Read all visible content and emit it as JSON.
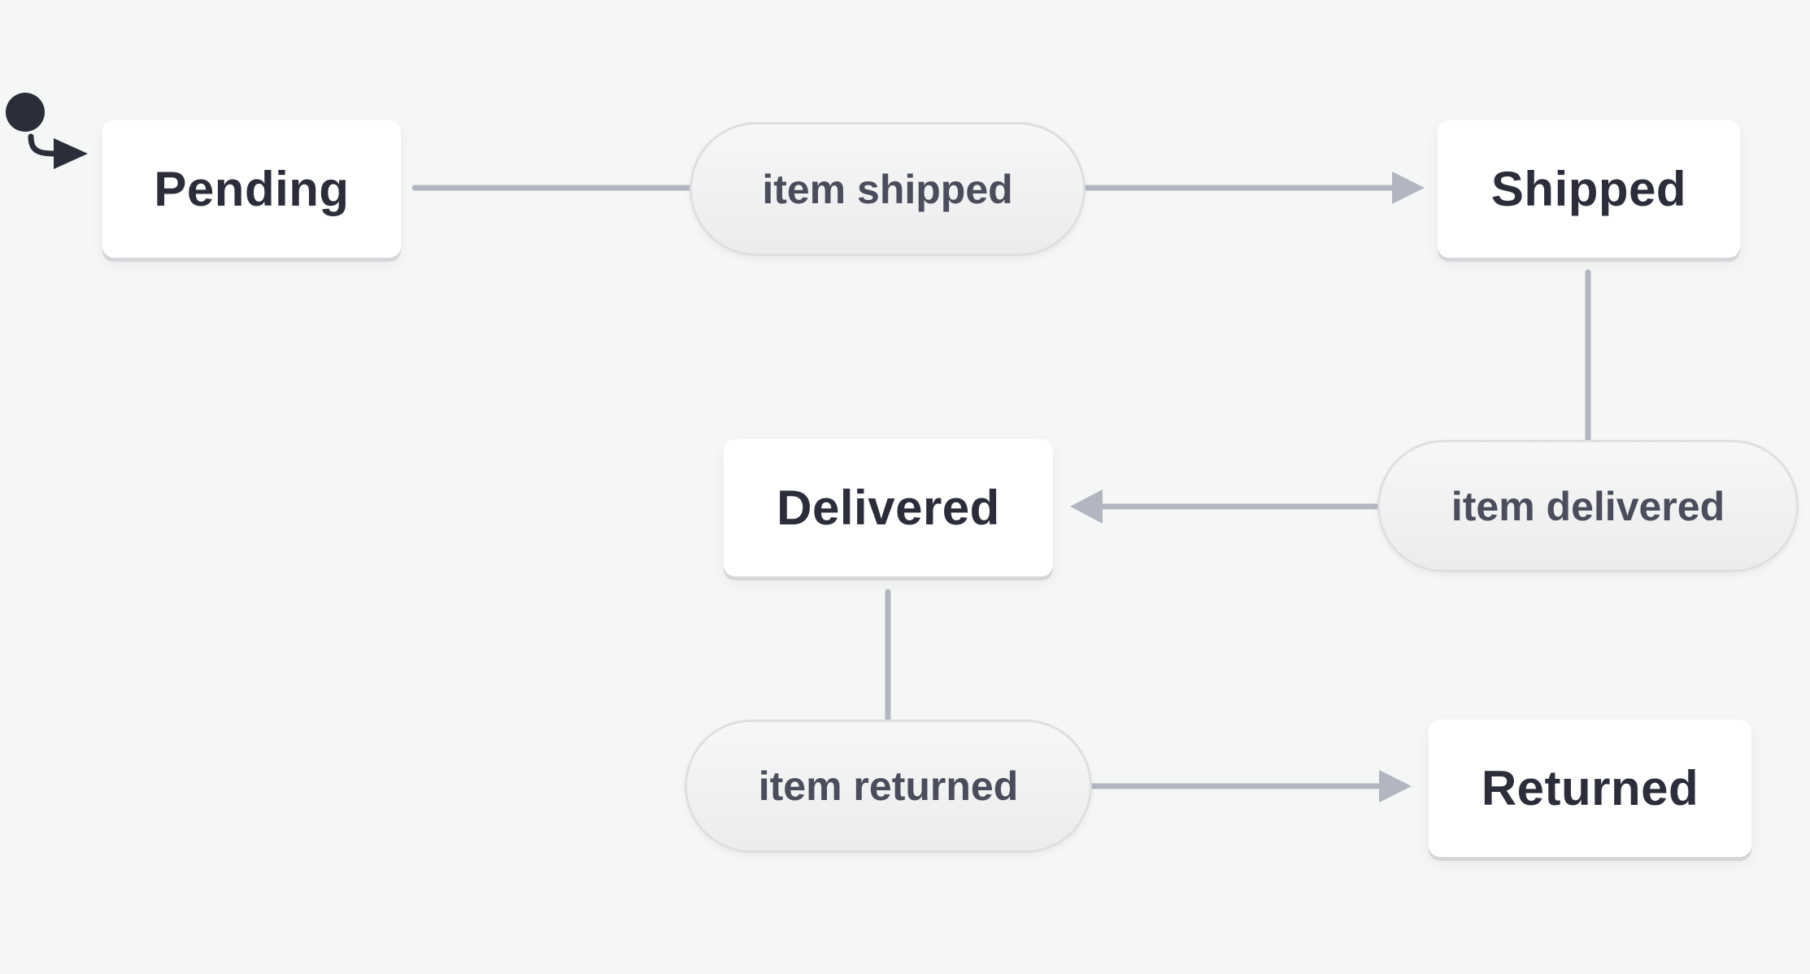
{
  "diagram": {
    "type": "state-machine",
    "initial_state": "Pending",
    "states": [
      {
        "id": "pending",
        "label": "Pending"
      },
      {
        "id": "shipped",
        "label": "Shipped"
      },
      {
        "id": "delivered",
        "label": "Delivered"
      },
      {
        "id": "returned",
        "label": "Returned"
      }
    ],
    "events": [
      {
        "id": "item-shipped",
        "label": "item shipped",
        "from": "Pending",
        "to": "Shipped"
      },
      {
        "id": "item-delivered",
        "label": "item delivered",
        "from": "Shipped",
        "to": "Delivered"
      },
      {
        "id": "item-returned",
        "label": "item returned",
        "from": "Delivered",
        "to": "Returned"
      }
    ],
    "colors": {
      "background": "#f5f7f6",
      "state_text": "#2b2d3a",
      "event_text": "#4b4d5c",
      "edge": "#b3b6c1",
      "initial_marker": "#2b2d3a"
    }
  }
}
